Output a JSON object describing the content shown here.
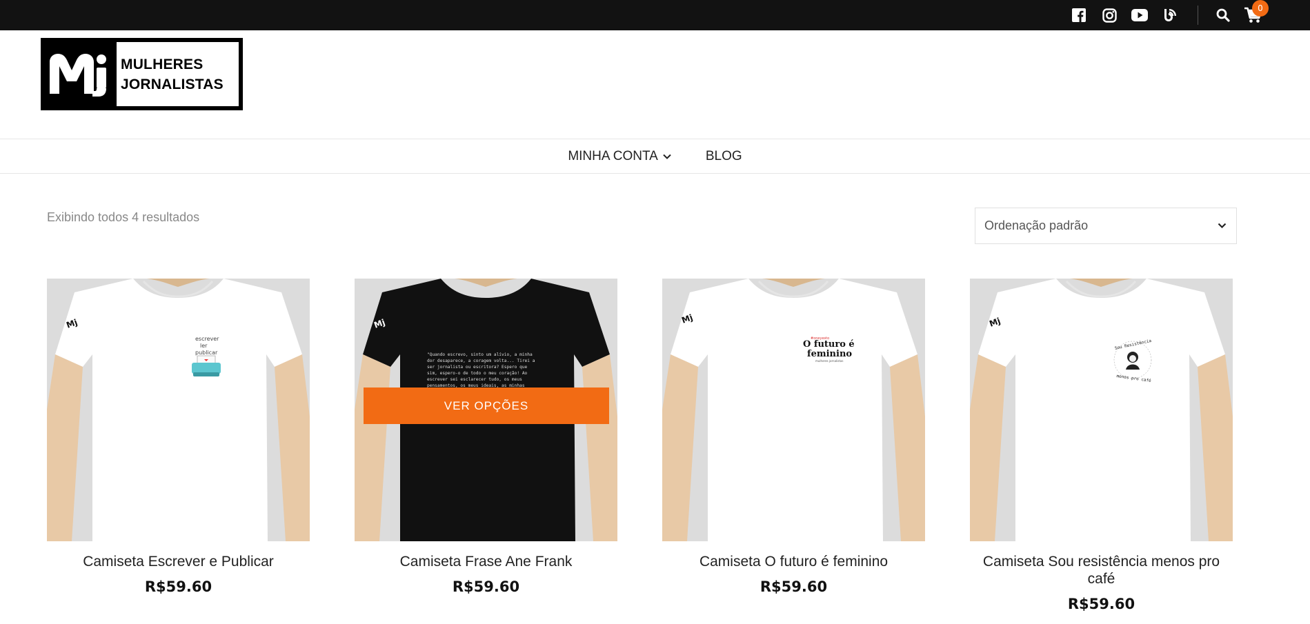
{
  "topbar": {
    "icons": [
      "facebook-icon",
      "instagram-icon",
      "youtube-icon",
      "blog-icon",
      "search-icon",
      "cart-icon"
    ],
    "cart_count": "0"
  },
  "logo": {
    "mark": "Mj",
    "line1": "MULHERES",
    "line2": "JORNALISTAS"
  },
  "nav": {
    "items": [
      {
        "label": "MINHA CONTA",
        "has_dropdown": true
      },
      {
        "label": "BLOG",
        "has_dropdown": false
      }
    ]
  },
  "shop": {
    "results_text": "Exibindo todos 4 resultados",
    "sort_selected": "Ordenação padrão"
  },
  "products": [
    {
      "title": "Camiseta Escrever e Publicar",
      "price": "R$59.60",
      "shirt_color": "#ffffff",
      "print_text": "escrever ler publicar"
    },
    {
      "title": "Camiseta Frase Ane Frank",
      "price": "R$59.60",
      "shirt_color": "#111111",
      "print_text": "\"Quando escrevo, sinto um alívio, a minha dor desaparece, a coragem volta... Tirei a ser jornalista ou escritora? Espero que sim, espero-o de todo o meu coração! Ao escrever sei esclarecer tudo, os meus pensamentos, os meus ideais, as minhas fantasias\" Anne Frank",
      "button": "VER OPÇÕES"
    },
    {
      "title": "Camiseta O futuro é feminino",
      "price": "R$59.60",
      "shirt_color": "#ffffff",
      "print_text": "O futuro é feminino"
    },
    {
      "title": "Camiseta Sou resistência menos pro café",
      "price": "R$59.60",
      "shirt_color": "#ffffff",
      "print_text": "Sou Resistência menos pro café"
    }
  ],
  "colors": {
    "topbar": "#121212",
    "accent": "#f26b14"
  }
}
